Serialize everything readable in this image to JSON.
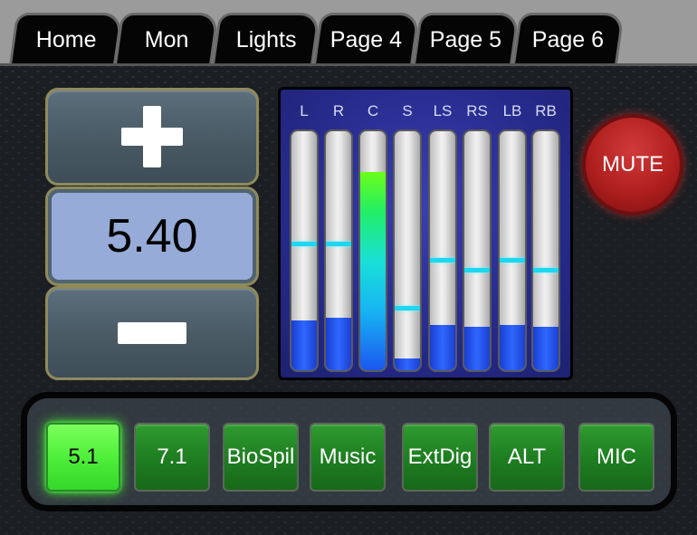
{
  "tabs": [
    {
      "label": "Home"
    },
    {
      "label": "Mon"
    },
    {
      "label": "Lights"
    },
    {
      "label": "Page 4"
    },
    {
      "label": "Page 5"
    },
    {
      "label": "Page 6"
    }
  ],
  "volume": {
    "value": "5.40",
    "up_icon": "plus-icon",
    "down_icon": "minus-icon"
  },
  "meters": {
    "channels": [
      {
        "label": "L",
        "level": 0.21,
        "peak": 0.52
      },
      {
        "label": "R",
        "level": 0.22,
        "peak": 0.52
      },
      {
        "label": "C",
        "level": 0.83,
        "peak": null
      },
      {
        "label": "S",
        "level": 0.05,
        "peak": 0.25
      },
      {
        "label": "LS",
        "level": 0.19,
        "peak": 0.45
      },
      {
        "label": "RS",
        "level": 0.18,
        "peak": 0.41
      },
      {
        "label": "LB",
        "level": 0.19,
        "peak": 0.45
      },
      {
        "label": "RB",
        "level": 0.18,
        "peak": 0.41
      }
    ]
  },
  "mute": {
    "label": "MUTE",
    "color": "#b01f1f"
  },
  "modes": [
    {
      "label": "5.1",
      "active": true
    },
    {
      "label": "7.1",
      "active": false
    },
    {
      "label": "BioSpil",
      "active": false
    },
    {
      "label": "Music",
      "active": false
    },
    {
      "label": "ExtDig",
      "active": false
    },
    {
      "label": "ALT",
      "active": false
    },
    {
      "label": "MIC",
      "active": false
    }
  ],
  "colors": {
    "meter_fill": "#2f67ff",
    "peak_marker": "#1ed6ee",
    "mode_active": "#4fef3a",
    "mode_inactive": "#1f7f22"
  }
}
